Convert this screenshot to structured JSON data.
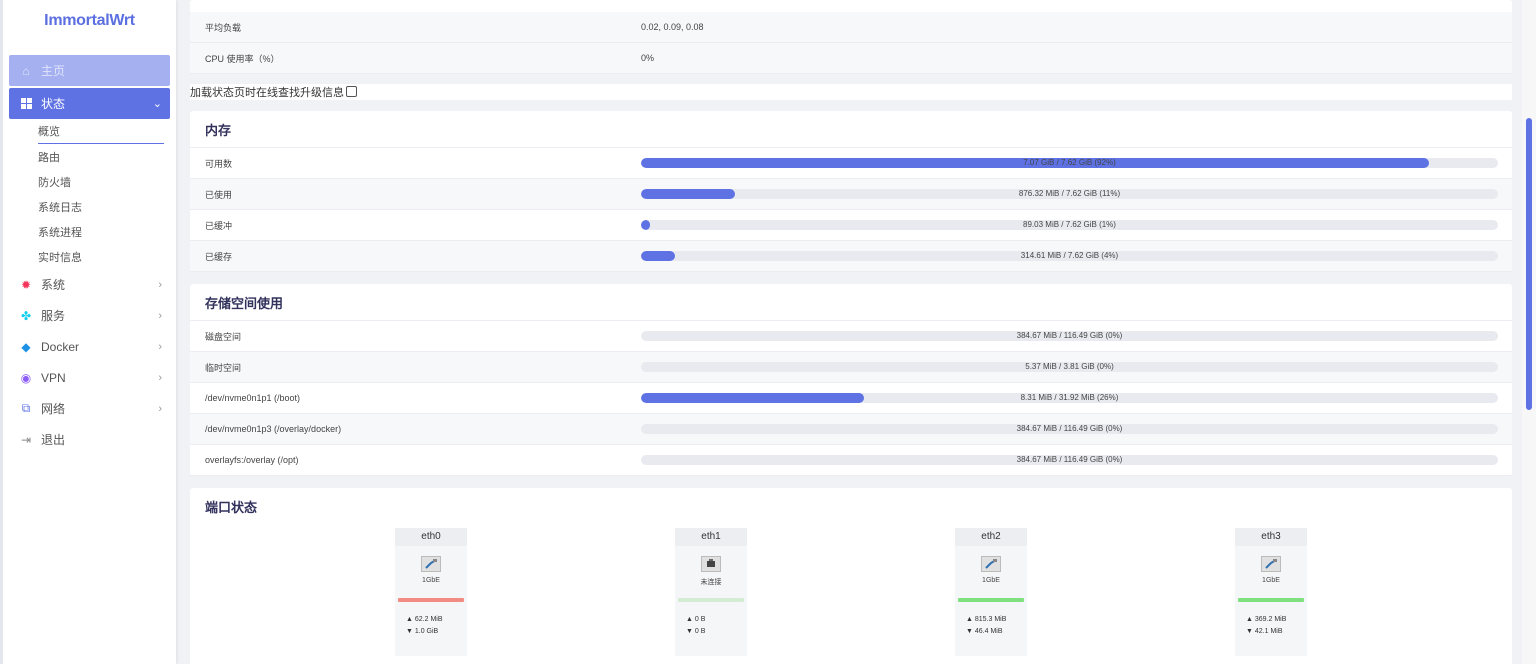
{
  "brand": "ImmortalWrt",
  "nav": {
    "home": "主页",
    "status": "状态",
    "status_sub": [
      "概览",
      "路由",
      "防火墙",
      "系统日志",
      "系统进程",
      "实时信息"
    ],
    "system": "系统",
    "services": "服务",
    "docker": "Docker",
    "vpn": "VPN",
    "network": "网络",
    "logout": "退出"
  },
  "system_rows": [
    {
      "label": "平均负载",
      "value": "0.02, 0.09, 0.08"
    },
    {
      "label": "CPU 使用率（%）",
      "value": "0%"
    }
  ],
  "upgrade_check_label": "加载状态页时在线查找升级信息",
  "memory": {
    "title": "内存",
    "rows": [
      {
        "label": "可用数",
        "text": "7.07 GiB / 7.62 GiB (92%)",
        "percent": 92
      },
      {
        "label": "已使用",
        "text": "876.32 MiB / 7.62 GiB (11%)",
        "percent": 11
      },
      {
        "label": "已缓冲",
        "text": "89.03 MiB / 7.62 GiB (1%)",
        "percent": 1
      },
      {
        "label": "已缓存",
        "text": "314.61 MiB / 7.62 GiB (4%)",
        "percent": 4
      }
    ]
  },
  "storage": {
    "title": "存储空间使用",
    "rows": [
      {
        "label": "磁盘空间",
        "text": "384.67 MiB / 116.49 GiB (0%)",
        "percent": 0
      },
      {
        "label": "临时空间",
        "text": "5.37 MiB / 3.81 GiB (0%)",
        "percent": 0
      },
      {
        "label": "/dev/nvme0n1p1 (/boot)",
        "text": "8.31 MiB / 31.92 MiB (26%)",
        "percent": 26
      },
      {
        "label": "/dev/nvme0n1p3 (/overlay/docker)",
        "text": "384.67 MiB / 116.49 GiB (0%)",
        "percent": 0
      },
      {
        "label": "overlayfs:/overlay (/opt)",
        "text": "384.67 MiB / 116.49 GiB (0%)",
        "percent": 0
      }
    ]
  },
  "ports": {
    "title": "端口状态",
    "items": [
      {
        "name": "eth0",
        "speed": "1GbE",
        "status_color": "#f28b82",
        "up": "▲ 62.2 MiB",
        "down": "▼ 1.0 GiB",
        "icon": "ethernet-connected-icon"
      },
      {
        "name": "eth1",
        "speed": "未连接",
        "status_color": "#d4ecd4",
        "up": "▲ 0 B",
        "down": "▼ 0 B",
        "icon": "ethernet-disconnected-icon"
      },
      {
        "name": "eth2",
        "speed": "1GbE",
        "status_color": "#7ee07e",
        "up": "▲ 815.3 MiB",
        "down": "▼ 46.4 MiB",
        "icon": "ethernet-connected-icon"
      },
      {
        "name": "eth3",
        "speed": "1GbE",
        "status_color": "#7ee07e",
        "up": "▲ 369.2 MiB",
        "down": "▼ 42.1 MiB",
        "icon": "ethernet-connected-icon"
      }
    ]
  }
}
